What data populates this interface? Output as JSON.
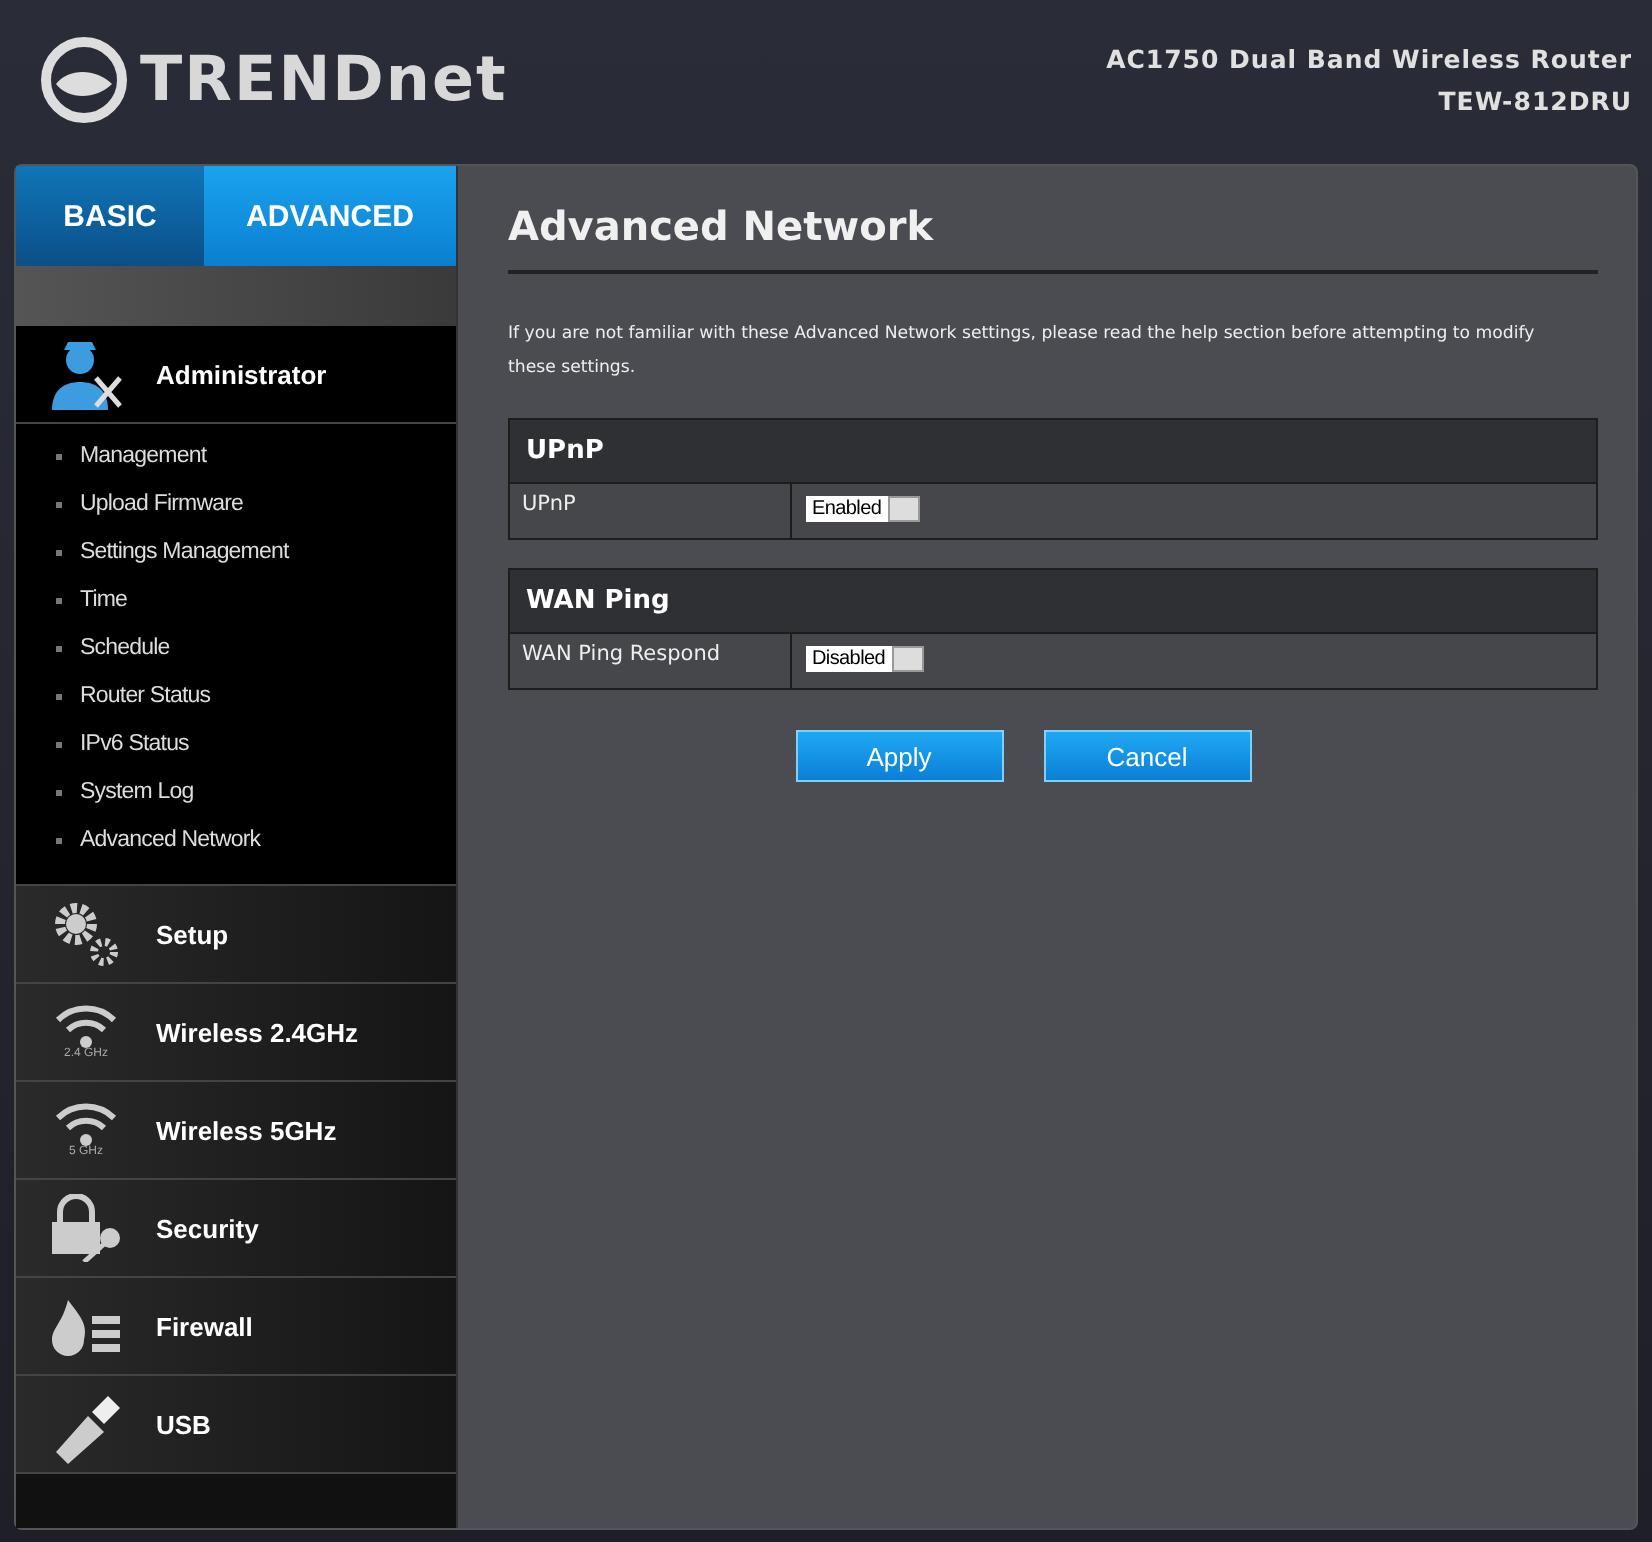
{
  "header": {
    "logo": "TRENDnet",
    "product": "AC1750 Dual Band Wireless Router",
    "model": "TEW-812DRU"
  },
  "tabs": [
    {
      "label": "BASIC",
      "selected": false
    },
    {
      "label": "ADVANCED",
      "selected": true
    }
  ],
  "sidebar": {
    "sections": [
      {
        "label": "Administrator",
        "kind": "admin",
        "expanded": true,
        "children": [
          {
            "label": "Management"
          },
          {
            "label": "Upload Firmware"
          },
          {
            "label": "Settings Management"
          },
          {
            "label": "Time"
          },
          {
            "label": "Schedule"
          },
          {
            "label": "Router Status"
          },
          {
            "label": "IPv6 Status"
          },
          {
            "label": "System Log"
          },
          {
            "label": "Advanced Network"
          }
        ]
      },
      {
        "label": "Setup",
        "kind": "gears",
        "expanded": false
      },
      {
        "label": "Wireless 2.4GHz",
        "kind": "wifi",
        "icon_caption": "2.4 GHz",
        "expanded": false
      },
      {
        "label": "Wireless 5GHz",
        "kind": "wifi",
        "icon_caption": "5 GHz",
        "expanded": false
      },
      {
        "label": "Security",
        "kind": "lock",
        "expanded": false
      },
      {
        "label": "Firewall",
        "kind": "firewall",
        "expanded": false
      },
      {
        "label": "USB",
        "kind": "usb",
        "expanded": false
      }
    ]
  },
  "page": {
    "title": "Advanced Network",
    "intro": "If you are not familiar with these Advanced Network settings, please read the help section before attempting to modify these settings.",
    "groups": [
      {
        "title": "UPnP",
        "rows": [
          {
            "label": "UPnP",
            "value": "Enabled"
          }
        ]
      },
      {
        "title": "WAN Ping",
        "rows": [
          {
            "label": "WAN Ping Respond",
            "value": "Disabled"
          }
        ]
      }
    ],
    "buttons": [
      "Apply",
      "Cancel"
    ]
  }
}
